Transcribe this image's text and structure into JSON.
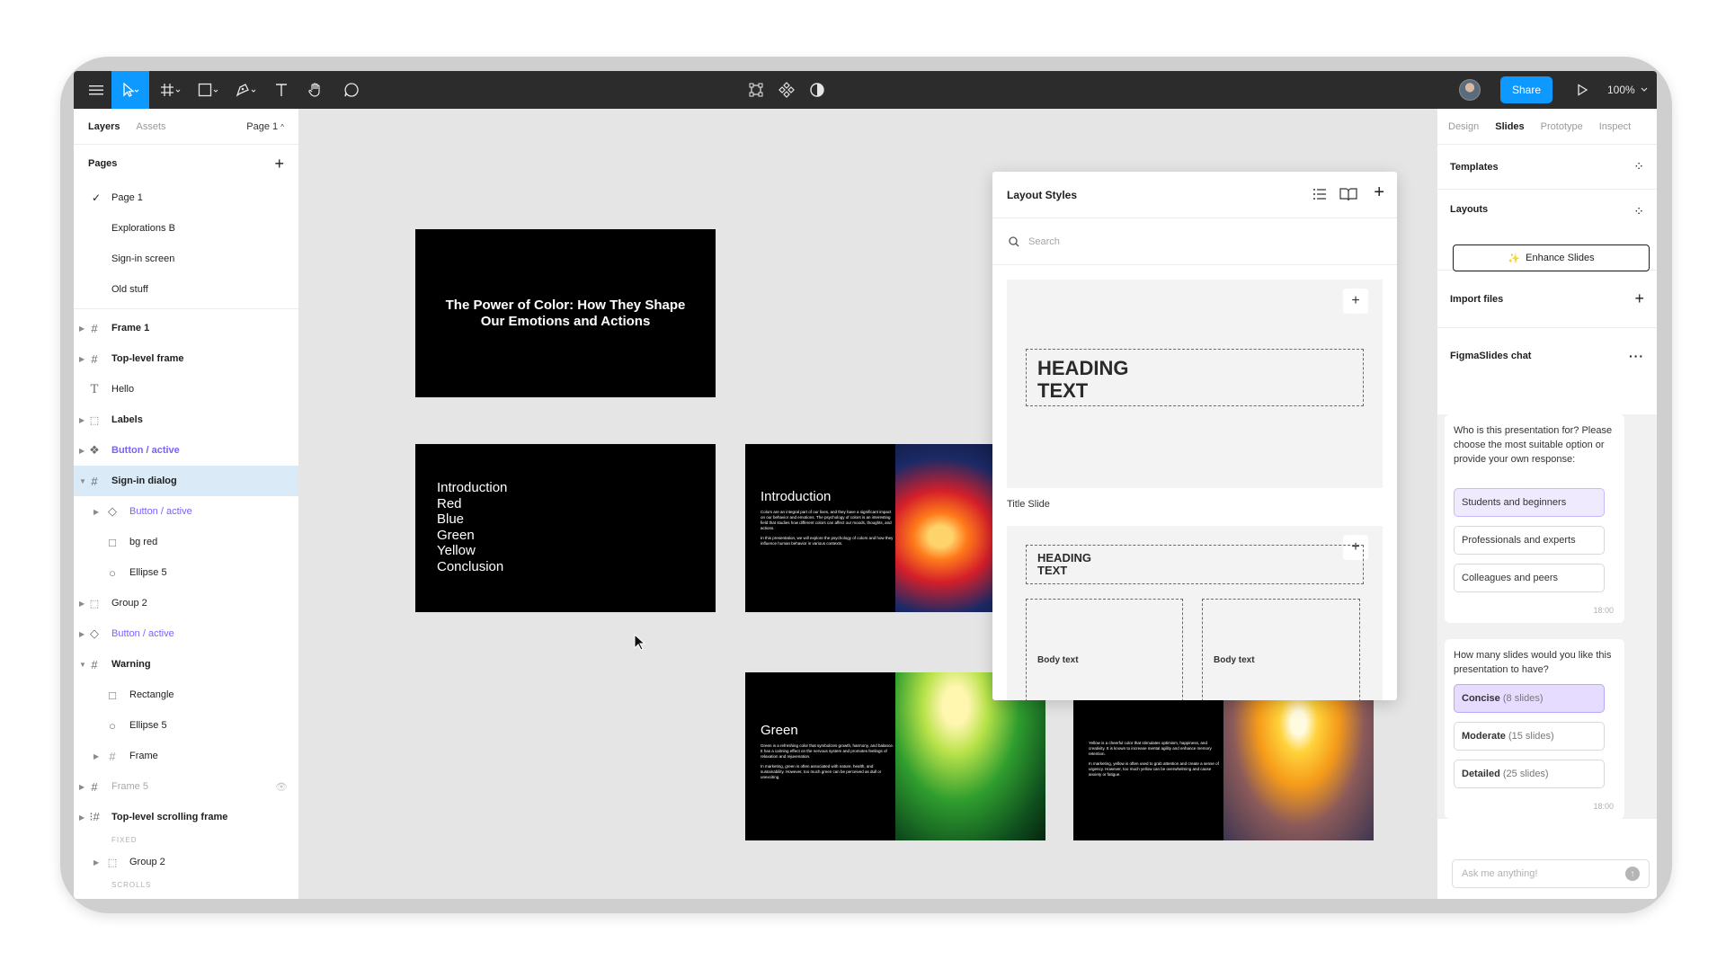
{
  "toolbar": {
    "share_label": "Share",
    "zoom_label": "100%"
  },
  "left_panel": {
    "tabs": {
      "layers": "Layers",
      "assets": "Assets",
      "page": "Page 1"
    },
    "pages_title": "Pages",
    "pages": [
      "Page 1",
      "Explorations B",
      "Sign-in screen",
      "Old stuff"
    ],
    "layers": [
      {
        "name": "Frame 1"
      },
      {
        "name": "Top-level frame"
      },
      {
        "name": "Hello"
      },
      {
        "name": "Labels"
      },
      {
        "name": "Button / active"
      },
      {
        "name": "Sign-in dialog"
      },
      {
        "name": "Button / active"
      },
      {
        "name": "bg red"
      },
      {
        "name": "Ellipse 5"
      },
      {
        "name": "Group 2"
      },
      {
        "name": "Button / active"
      },
      {
        "name": "Warning"
      },
      {
        "name": "Rectangle"
      },
      {
        "name": "Ellipse 5"
      },
      {
        "name": "Frame"
      },
      {
        "name": "Frame 5"
      },
      {
        "name": "Top-level scrolling frame"
      },
      {
        "name": "FIXED"
      },
      {
        "name": "Group 2"
      },
      {
        "name": "SCROLLS"
      }
    ]
  },
  "slides": {
    "title_slide": "The Power of Color: How They Shape Our Emotions and Actions",
    "agenda": [
      "Introduction",
      "Red",
      "Blue",
      "Green",
      "Yellow",
      "Conclusion"
    ],
    "intro_title": "Introduction",
    "intro_p1": "Colors are an integral part of our lives, and they have a significant impact on our behavior and emotions. The psychology of colors is an interesting field that studies how different colors can affect our moods, thoughts, and actions.",
    "intro_p2": "In this presentation, we will explore the psychology of colors and how they influence human behavior in various contexts.",
    "green_title": "Green",
    "green_p1": "Green is a refreshing color that symbolizes growth, harmony, and balance. It has a calming effect on the nervous system and promotes feelings of relaxation and rejuvenation.",
    "green_p2": "In marketing, green is often associated with nature, health, and sustainability. However, too much green can be perceived as dull or unexciting.",
    "yellow_p1": "Yellow is a cheerful color that stimulates optimism, happiness, and creativity. It is known to increase mental agility and enhance memory retention.",
    "yellow_p2": "In marketing, yellow is often used to grab attention and create a sense of urgency. However, too much yellow can be overwhelming and cause anxiety or fatigue."
  },
  "layout_styles": {
    "title": "Layout Styles",
    "search_placeholder": "Search",
    "card1_heading_l1": "HEADING",
    "card1_heading_l2": "TEXT",
    "card1_label": "Title Slide",
    "card2_heading_l1": "HEADING",
    "card2_heading_l2": "TEXT",
    "body_text": "Body text"
  },
  "right_panel": {
    "tabs": [
      "Design",
      "Slides",
      "Prototype",
      "Inspect"
    ],
    "templates": "Templates",
    "layouts": "Layouts",
    "enhance": "Enhance Slides",
    "import": "Import files",
    "chat_title": "FigmaSlides chat",
    "q1": "Who is this presentation for? Please choose the most suitable option or provide your own response:",
    "q1_options": [
      "Students and beginners",
      "Professionals and experts",
      "Colleagues and peers"
    ],
    "q1_time": "18:00",
    "q2": "How many slides would you like this presentation to have?",
    "q2_options": [
      {
        "label": "Concise",
        "detail": "(8 slides)"
      },
      {
        "label": "Moderate",
        "detail": "(15 slides)"
      },
      {
        "label": "Detailed",
        "detail": "(25 slides)"
      }
    ],
    "q2_time": "18:00",
    "ask_placeholder": "Ask me anything!"
  }
}
